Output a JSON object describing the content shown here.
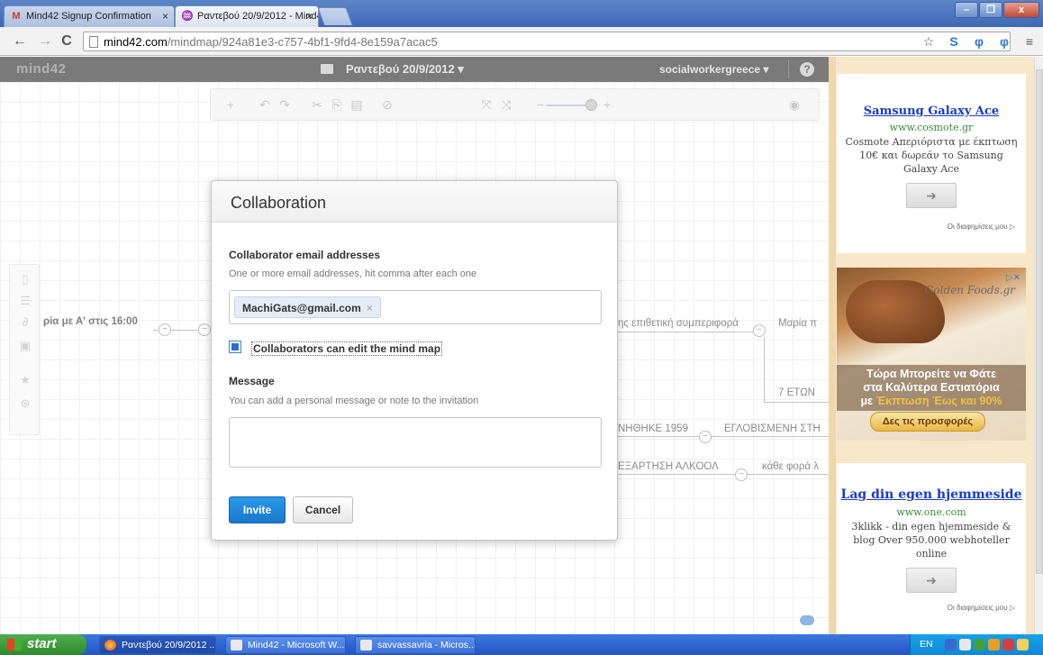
{
  "browser": {
    "tabs": [
      {
        "label": "Mind42 Signup Confirmation",
        "icon": "gmail-icon"
      },
      {
        "label": "Ραντεβού 20/9/2012 - Mind4",
        "icon": "mind42-icon"
      }
    ],
    "url_host": "mind42.com",
    "url_path": "/mindmap/924a81e3-c757-4bf1-9fd4-8e159a7acac5"
  },
  "app": {
    "logo": "mind42",
    "map_title": "Ραντεβού 20/9/2012 ▾",
    "user": "socialworkergreece ▾",
    "help": "?"
  },
  "nodes": {
    "n1": "ρία με Α' στις 16:00",
    "n2": "ης επιθετική συμπεριφορά",
    "n3": "Μαρία π",
    "n4": "7 ΕΤΩΝ",
    "n5": "ΝΗΘΗΚΕ 1959",
    "n6": "ΕΓΛΟΒΙΣΜΕΝΗ ΣΤΗ",
    "n7": "ΕΞΑΡΤΗΣΗ ΑΛΚΟΟΛ",
    "n8": "κάθε φορά λ"
  },
  "dialog": {
    "title": "Collaboration",
    "email_label": "Collaborator email addresses",
    "email_hint": "One or more email addresses, hit comma after each one",
    "email_tag": "MachiGats@gmail.com",
    "tag_remove": "×",
    "edit_checkbox_label": "Collaborators can edit the mind map",
    "edit_checked": true,
    "message_label": "Message",
    "message_hint": "You can add a personal message or note to the invitation",
    "message_value": "",
    "invite_button": "Invite",
    "cancel_button": "Cancel"
  },
  "ads": {
    "ad1": {
      "title": "Samsung Galaxy Ace",
      "url": "www.cosmote.gr",
      "text": "Cosmote Απεριόριστα με έκπτωση 10€ και δωρεάν το Samsung Galaxy Ace",
      "choices": "Οι διαφημίσεις μου ▷"
    },
    "ad2": {
      "brand": "Golden Foods.gr",
      "headline_1": "Τώρα Μπορείτε να Φάτε",
      "headline_2": "στα Καλύτερα Εστιατόρια",
      "headline_3a": "με ",
      "headline_3b": "Έκπτωση Έως και 90%",
      "cta": "Δες τις προσφορές"
    },
    "ad3": {
      "title": "Lag din egen hjemmeside",
      "url": "www.one.com",
      "text": "3klikk - din egen hjemmeside & blog Over 950.000 webhoteller online",
      "choices": "Οι διαφημίσεις μου ▷"
    }
  },
  "taskbar": {
    "start": "start",
    "items": [
      "Ραντεβού 20/9/2012 ...",
      "Mind42 - Microsoft W...",
      "savvassavria - Micros..."
    ],
    "lang": "EN"
  }
}
